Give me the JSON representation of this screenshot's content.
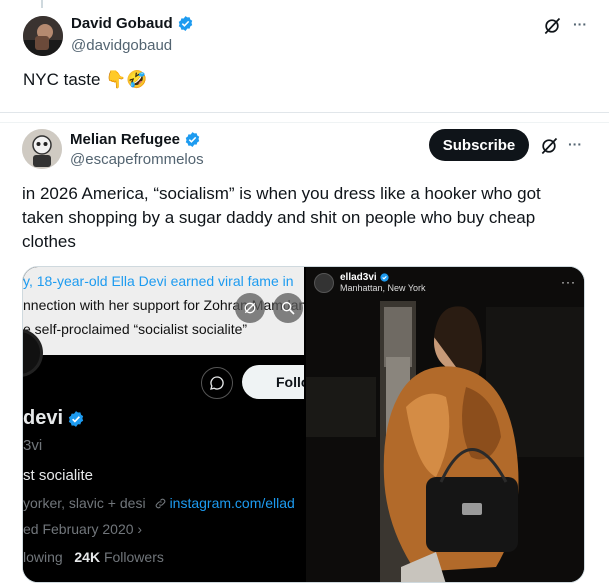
{
  "main_tweet": {
    "author_name": "David Gobaud",
    "author_handle": "@davidgobaud",
    "text": "NYC taste 👇🤣",
    "more_label": "···"
  },
  "quoted_tweet": {
    "author_name": "Melian Refugee",
    "author_handle": "@escapefrommelos",
    "subscribe_label": "Subscribe",
    "more_label": "···",
    "text_lines": [
      "in 2026 America, “socialism” is when you dress like a hooker who got",
      "taken shopping by a sugar daddy and shit on people who buy cheap",
      "clothes"
    ],
    "media_left": {
      "article_lines": [
        "y, 18-year-old Ella Devi earned viral fame in",
        "nnection with her support for Zohran Mamdani",
        "e self-proclaimed “socialist socialite”"
      ],
      "profile": {
        "follow_label": "Follo",
        "name": "devi",
        "handle": "3vi",
        "bio": "st socialite",
        "meta_text": "yorker, slavic + desi",
        "link": "instagram.com/ellad",
        "joined": "ed February 2020",
        "following_label": "lowing",
        "followers_count": "24K",
        "followers_label": "Followers"
      }
    },
    "media_right": {
      "ig_user": "ellad3vi",
      "ig_location": "Manhattan, New York",
      "more_label": "···"
    }
  },
  "colors": {
    "verified_blue": "#1d9bf0",
    "text_primary": "#0f1419",
    "text_secondary": "#536471",
    "subscribe_bg": "#0f1419"
  }
}
